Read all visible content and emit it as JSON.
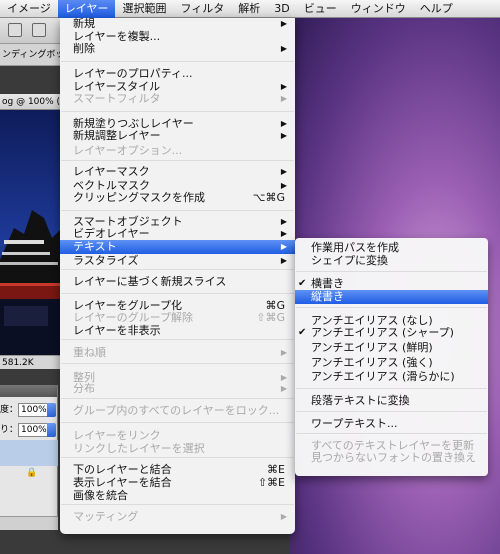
{
  "menubar": {
    "items": [
      "イメージ",
      "レイヤー",
      "選択範囲",
      "フィルタ",
      "解析",
      "3D",
      "ビュー",
      "ウィンドウ",
      "ヘルプ"
    ],
    "active_index": 1
  },
  "background_app": {
    "toolbar_text": "ンディングボックス",
    "doc_tab": "og @ 100% (",
    "status": "581.2K",
    "opacity_label": "度：",
    "opacity_value": "100%",
    "fill_label": "り：",
    "fill_value": "100%"
  },
  "layer_menu": {
    "items": [
      {
        "label": "新規",
        "submenu": true
      },
      {
        "label": "レイヤーを複製..."
      },
      {
        "label": "削除",
        "submenu": true
      },
      {
        "label": "レイヤーのプロパティ..."
      },
      {
        "label": "レイヤースタイル",
        "submenu": true
      },
      {
        "label": "スマートフィルタ",
        "disabled": true,
        "submenu": true
      },
      {
        "label": "新規塗りつぶしレイヤー",
        "submenu": true
      },
      {
        "label": "新規調整レイヤー",
        "submenu": true
      },
      {
        "label": "レイヤーオプション...",
        "disabled": true
      },
      {
        "label": "レイヤーマスク",
        "submenu": true
      },
      {
        "label": "ベクトルマスク",
        "submenu": true
      },
      {
        "label": "クリッピングマスクを作成",
        "shortcut": "⌥⌘G"
      },
      {
        "label": "スマートオブジェクト",
        "submenu": true
      },
      {
        "label": "ビデオレイヤー",
        "submenu": true
      },
      {
        "label": "テキスト",
        "submenu": true,
        "highlighted": true
      },
      {
        "label": "ラスタライズ",
        "submenu": true
      },
      {
        "label": "レイヤーに基づく新規スライス"
      },
      {
        "label": "レイヤーをグループ化",
        "shortcut": "⌘G"
      },
      {
        "label": "レイヤーのグループ解除",
        "shortcut": "⇧⌘G",
        "disabled": true
      },
      {
        "label": "レイヤーを非表示"
      },
      {
        "label": "重ね順",
        "disabled": true,
        "submenu": true
      },
      {
        "label": "整列",
        "disabled": true,
        "submenu": true
      },
      {
        "label": "分布",
        "disabled": true,
        "submenu": true
      },
      {
        "label": "グループ内のすべてのレイヤーをロック...",
        "disabled": true
      },
      {
        "label": "レイヤーをリンク",
        "disabled": true
      },
      {
        "label": "リンクしたレイヤーを選択",
        "disabled": true
      },
      {
        "label": "下のレイヤーと結合",
        "shortcut": "⌘E"
      },
      {
        "label": "表示レイヤーを結合",
        "shortcut": "⇧⌘E"
      },
      {
        "label": "画像を統合"
      },
      {
        "label": "マッティング",
        "disabled": true,
        "submenu": true
      }
    ]
  },
  "text_submenu": {
    "items": [
      {
        "label": "作業用パスを作成"
      },
      {
        "label": "シェイプに変換"
      },
      {
        "label": "横書き",
        "checked": true
      },
      {
        "label": "縦書き",
        "highlighted": true
      },
      {
        "label": "アンチエイリアス (なし)"
      },
      {
        "label": "アンチエイリアス (シャープ)",
        "checked": true
      },
      {
        "label": "アンチエイリアス (鮮明)"
      },
      {
        "label": "アンチエイリアス (強く)"
      },
      {
        "label": "アンチエイリアス (滑らかに)"
      },
      {
        "label": "段落テキストに変換"
      },
      {
        "label": "ワープテキスト..."
      },
      {
        "label": "すべてのテキストレイヤーを更新",
        "disabled": true
      },
      {
        "label": "見つからないフォントの置き換え",
        "disabled": true
      }
    ]
  },
  "glyphs": {
    "submenu_arrow": "▶",
    "check": "✔"
  },
  "colors": {
    "highlight": "#2f6ae6",
    "disabled_text": "#a9a9a9"
  }
}
